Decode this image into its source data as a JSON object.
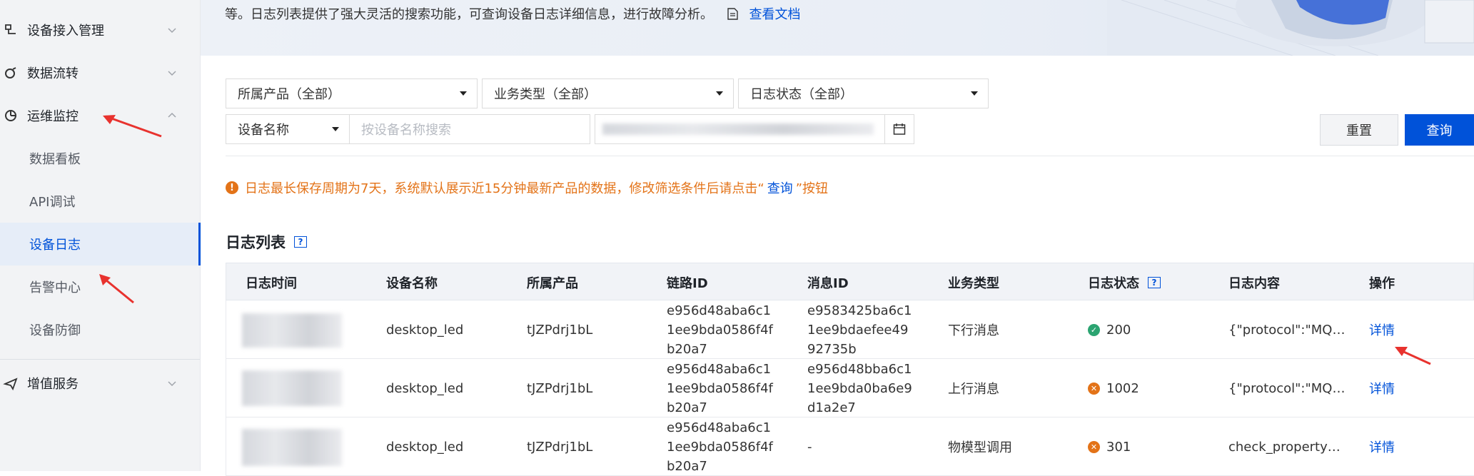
{
  "sidebar": {
    "items": [
      {
        "label": "设备接入管理",
        "icon": "device-access-icon"
      },
      {
        "label": "数据流转",
        "icon": "data-flow-icon"
      },
      {
        "label": "运维监控",
        "icon": "monitor-icon"
      },
      {
        "label": "增值服务",
        "icon": "value-service-icon"
      }
    ],
    "sub_items": [
      {
        "label": "数据看板"
      },
      {
        "label": "API调试"
      },
      {
        "label": "设备日志"
      },
      {
        "label": "告警中心"
      },
      {
        "label": "设备防御"
      }
    ]
  },
  "banner": {
    "text": "等。日志列表提供了强大灵活的搜索功能，可查询设备日志详细信息，进行故障分析。",
    "doc_link": "查看文档"
  },
  "filters": {
    "product": "所属产品（全部）",
    "business_type": "业务类型（全部）",
    "log_status": "日志状态（全部）",
    "field_select": "设备名称",
    "search_placeholder": "按设备名称搜索",
    "reset_label": "重置",
    "query_label": "查询"
  },
  "notice": {
    "before": "日志最长保存周期为7天，系统默认展示近15分钟最新产品的数据，修改筛选条件后请点击“",
    "query": "查询",
    "after": "”按钮"
  },
  "list": {
    "title": "日志列表",
    "columns": [
      "日志时间",
      "设备名称",
      "所属产品",
      "链路ID",
      "消息ID",
      "业务类型",
      "日志状态",
      "日志内容",
      "操作"
    ],
    "rows": [
      {
        "device": "desktop_led",
        "product": "tJZPdrj1bL",
        "link_id": "e956d48aba6c11ee9bda0586f4fb20a7",
        "msg_id": "e9583425ba6c11ee9bdaefee4992735b",
        "business": "下行消息",
        "status": "200",
        "status_type": "ok",
        "content": "{\"protocol\":\"MQ…",
        "action": "详情"
      },
      {
        "device": "desktop_led",
        "product": "tJZPdrj1bL",
        "link_id": "e956d48aba6c11ee9bda0586f4fb20a7",
        "msg_id": "e956d48bba6c11ee9bda0ba6e9d1a2e7",
        "business": "上行消息",
        "status": "1002",
        "status_type": "error",
        "content": "{\"protocol\":\"MQ…",
        "action": "详情"
      },
      {
        "device": "desktop_led",
        "product": "tJZPdrj1bL",
        "link_id": "e956d48aba6c11ee9bda0586f4fb20a7",
        "msg_id": "-",
        "business": "物模型调用",
        "status": "301",
        "status_type": "error",
        "content": "check_property…",
        "action": "详情"
      }
    ]
  },
  "colors": {
    "accent": "#0052d9",
    "warning": "#e37318",
    "success": "#2ba471",
    "annotation": "#e8322e"
  }
}
